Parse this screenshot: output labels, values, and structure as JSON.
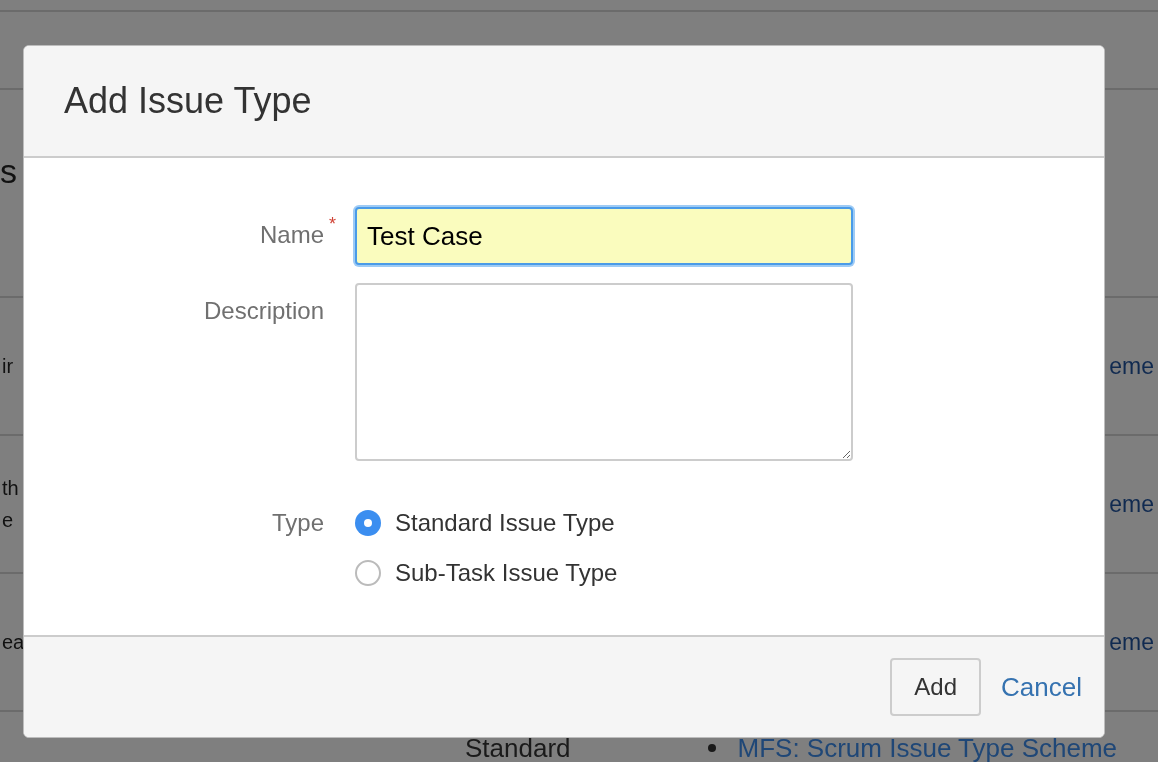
{
  "background": {
    "heading_fragment": "s",
    "rows": [
      {
        "left": [
          "ir"
        ],
        "right": "eme"
      },
      {
        "left": [
          "th",
          "e"
        ],
        "right": "eme"
      },
      {
        "left": [
          "ea"
        ],
        "right": "eme"
      }
    ],
    "last_row": {
      "type": "Standard",
      "scheme": "MFS: Scrum Issue Type Scheme"
    }
  },
  "dialog": {
    "title": "Add Issue Type",
    "required_mark": "*",
    "fields": [
      {
        "kind": "text",
        "label": "Name",
        "required": true,
        "value": "Test Case",
        "focused": true
      },
      {
        "kind": "textarea",
        "label": "Description",
        "required": false,
        "focused": false
      }
    ],
    "type": {
      "label": "Type",
      "options": [
        {
          "label": "Standard Issue Type",
          "selected": true
        },
        {
          "label": "Sub-Task Issue Type",
          "selected": false
        }
      ]
    },
    "buttons": [
      {
        "kind": "button",
        "label": "Add"
      },
      {
        "kind": "link",
        "label": "Cancel"
      }
    ]
  }
}
